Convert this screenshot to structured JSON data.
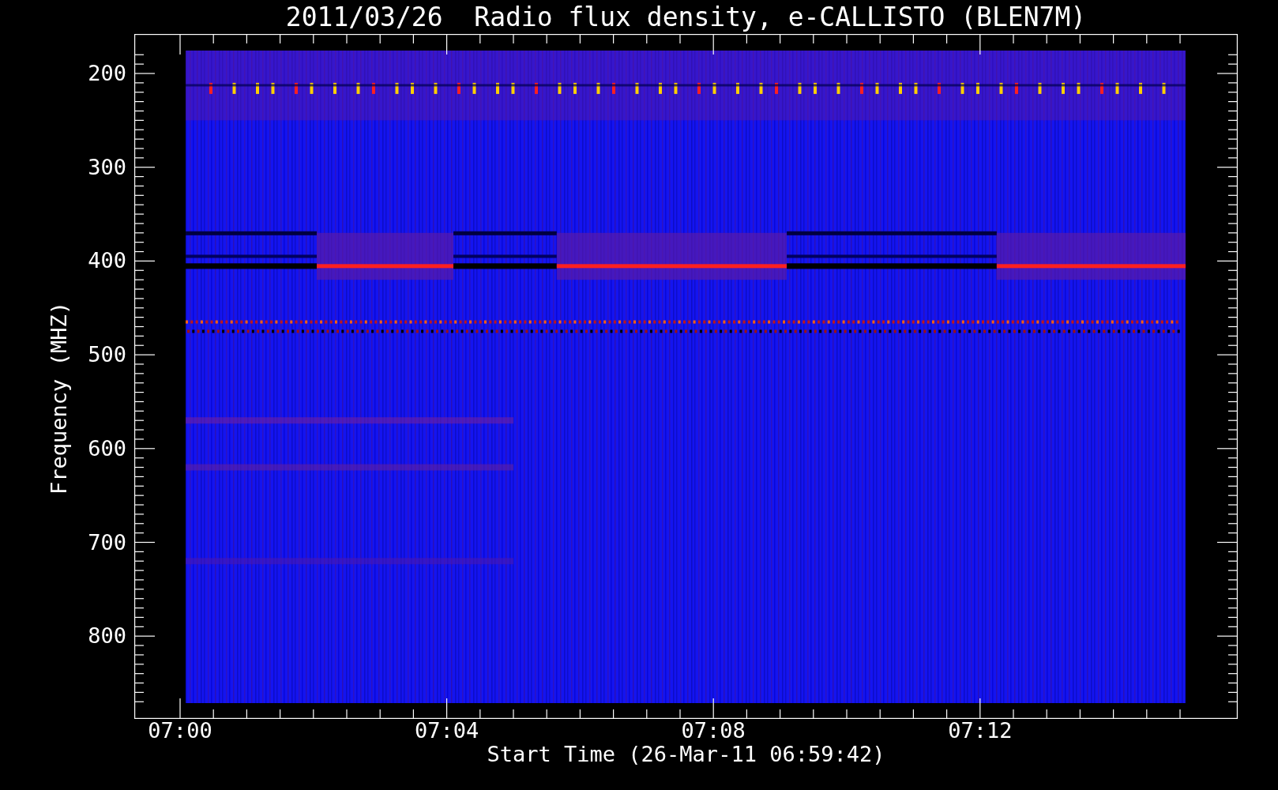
{
  "title": "2011/03/26  Radio flux density, e-CALLISTO (BLEN7M)",
  "y_axis": {
    "label": "Frequency (MHZ)",
    "ticks": [
      "200",
      "300",
      "400",
      "500",
      "600",
      "700",
      "800"
    ]
  },
  "x_axis": {
    "label": "Start Time (26-Mar-11 06:59:42)",
    "ticks": [
      "07:00",
      "07:04",
      "07:08",
      "07:12"
    ]
  }
}
